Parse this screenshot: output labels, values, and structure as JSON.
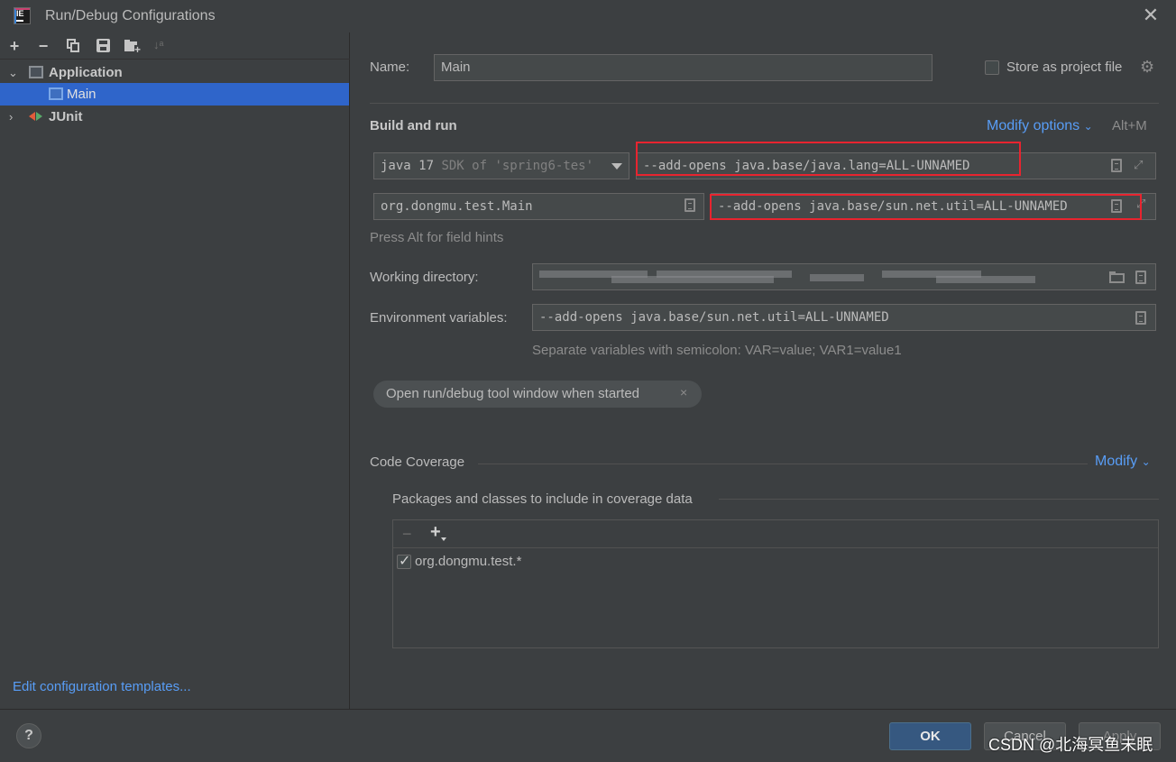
{
  "window": {
    "title": "Run/Debug Configurations",
    "logo_text": "IE"
  },
  "left_panel": {
    "toolbar_icons": [
      "add-icon",
      "remove-icon",
      "copy-icon",
      "save-icon",
      "new-folder-icon",
      "sort-icon"
    ],
    "tree": [
      {
        "label": "Application",
        "expanded": true,
        "children": [
          {
            "label": "Main",
            "selected": true
          }
        ]
      },
      {
        "label": "JUnit",
        "expanded": false
      }
    ],
    "edit_templates_link": "Edit configuration templates..."
  },
  "form": {
    "name_label": "Name:",
    "name_value": "Main",
    "store_checkbox_label": "Store as project file",
    "store_checked": false,
    "build_and_run_heading": "Build and run",
    "modify_options_link": "Modify options",
    "modify_options_shortcut": "Alt+M",
    "jdk_select": {
      "selected_prefix": "java 17",
      "selected_suffix": "SDK of 'spring6-tes'"
    },
    "vm_options_value": "--add-opens java.base/java.lang=ALL-UNNAMED",
    "main_class_value": "org.dongmu.test.Main",
    "program_args_value": "--add-opens java.base/sun.net.util=ALL-UNNAMED",
    "field_hints": "Press Alt for field hints",
    "working_dir_label": "Working directory:",
    "env_vars_label": "Environment variables:",
    "env_vars_value": "--add-opens java.base/sun.net.util=ALL-UNNAMED",
    "env_vars_hint": "Separate variables with semicolon: VAR=value; VAR1=value1",
    "chip_label": "Open run/debug tool window when started",
    "chip_close": "×"
  },
  "coverage": {
    "heading": "Code Coverage",
    "modify_link": "Modify",
    "packages_label": "Packages and classes to include in coverage data",
    "entries": [
      {
        "pattern": "org.dongmu.test.*",
        "checked": true
      }
    ]
  },
  "buttons": {
    "help": "?",
    "ok": "OK",
    "cancel": "Cancel",
    "apply": "Apply"
  },
  "watermark": "CSDN @北海冥鱼未眠",
  "colors": {
    "accent_link": "#589df6",
    "selection": "#2f65ca",
    "highlight_box": "#e8242f",
    "primary_button": "#365880"
  }
}
